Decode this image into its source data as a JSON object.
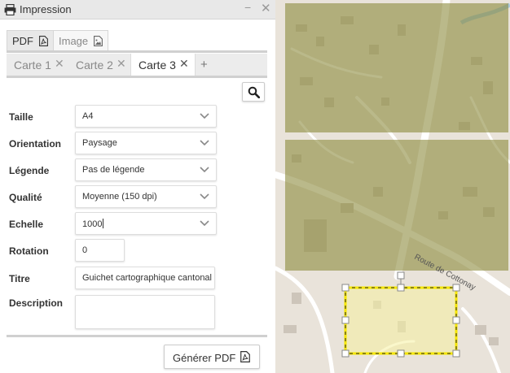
{
  "window": {
    "title": "Impression",
    "printer_icon": "printer-icon",
    "minimize_label": "−",
    "close_label": "✕"
  },
  "format_tabs": [
    {
      "label": "PDF",
      "icon": "file-pdf-icon",
      "active": true
    },
    {
      "label": "Image",
      "icon": "file-image-icon",
      "active": false
    }
  ],
  "carte_tabs": [
    {
      "label": "Carte 1",
      "active": false
    },
    {
      "label": "Carte 2",
      "active": false
    },
    {
      "label": "Carte 3",
      "active": true
    }
  ],
  "tab_close": "✕",
  "add_tab_label": "+",
  "form": {
    "taille": {
      "label": "Taille",
      "value": "A4"
    },
    "orientation": {
      "label": "Orientation",
      "value": "Paysage"
    },
    "legende": {
      "label": "Légende",
      "value": "Pas de légende"
    },
    "qualite": {
      "label": "Qualité",
      "value": "Moyenne (150 dpi)"
    },
    "echelle": {
      "label": "Echelle",
      "value": "1000"
    },
    "rotation": {
      "label": "Rotation",
      "value": "0"
    },
    "titre": {
      "label": "Titre",
      "value": "Guichet cartographique cantonal"
    },
    "description": {
      "label": "Description",
      "value": ""
    }
  },
  "generate_button": {
    "label": "Générer PDF",
    "icon": "file-pdf-icon"
  },
  "map": {
    "road_label": "Route de Cottonay",
    "selection_color": "#f5e600",
    "overlay_color": "#8c8a3c"
  }
}
